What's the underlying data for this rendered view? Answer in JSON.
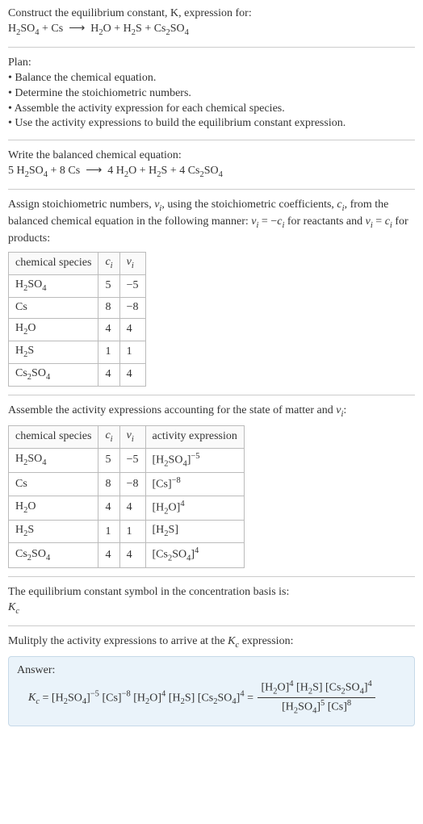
{
  "header": {
    "line1": "Construct the equilibrium constant, K, expression for:",
    "equation": "H₂SO₄ + Cs ⟶ H₂O + H₂S + Cs₂SO₄"
  },
  "plan": {
    "title": "Plan:",
    "items": [
      "• Balance the chemical equation.",
      "• Determine the stoichiometric numbers.",
      "• Assemble the activity expression for each chemical species.",
      "• Use the activity expressions to build the equilibrium constant expression."
    ]
  },
  "balanced": {
    "title": "Write the balanced chemical equation:",
    "equation": "5 H₂SO₄ + 8 Cs ⟶ 4 H₂O + H₂S + 4 Cs₂SO₄"
  },
  "assign": {
    "text": "Assign stoichiometric numbers, νᵢ, using the stoichiometric coefficients, cᵢ, from the balanced chemical equation in the following manner: νᵢ = −cᵢ for reactants and νᵢ = cᵢ for products:",
    "table": {
      "headers": [
        "chemical species",
        "cᵢ",
        "νᵢ"
      ],
      "rows": [
        [
          "H₂SO₄",
          "5",
          "−5"
        ],
        [
          "Cs",
          "8",
          "−8"
        ],
        [
          "H₂O",
          "4",
          "4"
        ],
        [
          "H₂S",
          "1",
          "1"
        ],
        [
          "Cs₂SO₄",
          "4",
          "4"
        ]
      ]
    }
  },
  "activity": {
    "text": "Assemble the activity expressions accounting for the state of matter and νᵢ:",
    "table": {
      "headers": [
        "chemical species",
        "cᵢ",
        "νᵢ",
        "activity expression"
      ],
      "rows": [
        [
          "H₂SO₄",
          "5",
          "−5",
          "[H₂SO₄]⁻⁵"
        ],
        [
          "Cs",
          "8",
          "−8",
          "[Cs]⁻⁸"
        ],
        [
          "H₂O",
          "4",
          "4",
          "[H₂O]⁴"
        ],
        [
          "H₂S",
          "1",
          "1",
          "[H₂S]"
        ],
        [
          "Cs₂SO₄",
          "4",
          "4",
          "[Cs₂SO₄]⁴"
        ]
      ]
    }
  },
  "symbol": {
    "line": "The equilibrium constant symbol in the concentration basis is:",
    "value": "K_c"
  },
  "multiply": {
    "line": "Mulitply the activity expressions to arrive at the K_c expression:"
  },
  "answer": {
    "label": "Answer:",
    "lhs": "K_c = [H₂SO₄]⁻⁵ [Cs]⁻⁸ [H₂O]⁴ [H₂S] [Cs₂SO₄]⁴ =",
    "num": "[H₂O]⁴ [H₂S] [Cs₂SO₄]⁴",
    "den": "[H₂SO₄]⁵ [Cs]⁸"
  }
}
